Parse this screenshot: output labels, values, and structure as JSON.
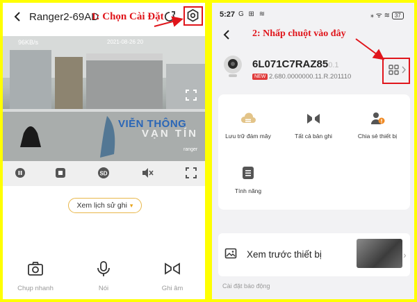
{
  "left": {
    "title": "Ranger2-69AD",
    "annotation": "1: Chọn Cài Đặt",
    "video": {
      "speed": "96KB/s",
      "datetime": "2021-08-26  20",
      "logo_line1": "VIỄN THÔNG",
      "logo_line2": "VẠN TÍN",
      "watermark": "ranger"
    },
    "controls": [
      "pause-icon",
      "record-icon",
      "sd-icon",
      "mute-icon",
      "fullscreen-icon"
    ],
    "sd_label": "SD",
    "history_button": "Xem lịch sử ghi",
    "bottom": [
      {
        "icon": "camera-icon",
        "label": "Chụp nhanh"
      },
      {
        "icon": "microphone-icon",
        "label": "Nói"
      },
      {
        "icon": "video-record-icon",
        "label": "Ghi âm"
      }
    ]
  },
  "right": {
    "status": {
      "time": "5:27",
      "icons": "G ⊞ ≋",
      "right": "⁎ ᯤ ≋",
      "battery": "37"
    },
    "annotation": "2: Nhấp chuột vào đây",
    "device": {
      "name": "6L071C7RAZ85",
      "name_fade": "0.1",
      "new_badge": "NEW",
      "version": "2.680.0000000.11.R.201110"
    },
    "features": [
      {
        "icon": "cloud-storage-icon",
        "label": "Lưu trữ đám mây"
      },
      {
        "icon": "all-recordings-icon",
        "label": "Tất cả bản ghi"
      },
      {
        "icon": "share-device-icon",
        "label": "Chia sẻ thiết bị"
      },
      {
        "icon": "features-icon",
        "label": "Tính năng"
      }
    ],
    "preview_label": "Xem trước thiết bị",
    "section_label": "Cài đặt báo động",
    "colors": {
      "accent": "#e0151b",
      "badge": "#e03b3b",
      "gold": "#e8b74a"
    }
  }
}
